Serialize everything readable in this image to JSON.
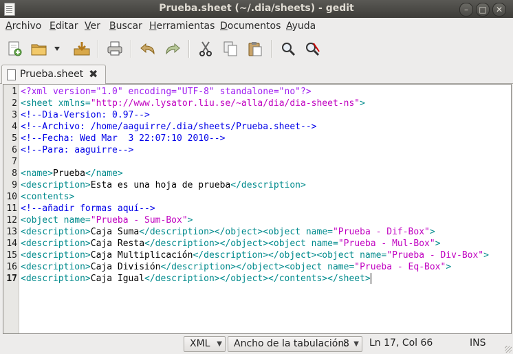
{
  "window": {
    "title": "Prueba.sheet (~/.dia/sheets) - gedit",
    "controls": {
      "minimize": "–",
      "maximize": "□",
      "close": "✕"
    }
  },
  "menu": {
    "items": [
      "Archivo",
      "Editar",
      "Ver",
      "Buscar",
      "Herramientas",
      "Documentos",
      "Ayuda"
    ]
  },
  "toolbar": {
    "icons": [
      "new-document-icon",
      "open-icon",
      "open-dropdown-icon",
      "save-icon",
      "print-icon",
      "undo-icon",
      "redo-icon",
      "cut-icon",
      "copy-icon",
      "paste-icon",
      "find-icon",
      "find-replace-icon"
    ]
  },
  "tab": {
    "label": "Prueba.sheet",
    "close": "✖"
  },
  "editor": {
    "current_line": 17,
    "lines": [
      [
        [
          "pi",
          "<?xml version=\"1.0\" encoding=\"UTF-8\" standalone=\"no\"?>"
        ]
      ],
      [
        [
          "tag",
          "<sheet "
        ],
        [
          "attr",
          "xmlns="
        ],
        [
          "str",
          "\"http://www.lysator.liu.se/~alla/dia/dia-sheet-ns\""
        ],
        [
          "tag",
          ">"
        ]
      ],
      [
        [
          "com",
          "<!--Dia-Version: 0.97-->"
        ]
      ],
      [
        [
          "com",
          "<!--Archivo: /home/aaguirre/.dia/sheets/Prueba.sheet-->"
        ]
      ],
      [
        [
          "com",
          "<!--Fecha: Wed Mar  3 22:07:10 2010-->"
        ]
      ],
      [
        [
          "com",
          "<!--Para: aaguirre-->"
        ]
      ],
      [
        [
          "txt",
          ""
        ]
      ],
      [
        [
          "tag",
          "<name>"
        ],
        [
          "txt",
          "Prueba"
        ],
        [
          "tag",
          "</name>"
        ]
      ],
      [
        [
          "tag",
          "<description>"
        ],
        [
          "txt",
          "Esta es una hoja de prueba"
        ],
        [
          "tag",
          "</description>"
        ]
      ],
      [
        [
          "tag",
          "<contents>"
        ]
      ],
      [
        [
          "com",
          "<!--añadir formas aquí-->"
        ]
      ],
      [
        [
          "tag",
          "<object "
        ],
        [
          "attr",
          "name="
        ],
        [
          "str",
          "\"Prueba - Sum-Box\""
        ],
        [
          "tag",
          ">"
        ]
      ],
      [
        [
          "tag",
          "<description>"
        ],
        [
          "txt",
          "Caja Suma"
        ],
        [
          "tag",
          "</description></object><object "
        ],
        [
          "attr",
          "name="
        ],
        [
          "str",
          "\"Prueba - Dif-Box\""
        ],
        [
          "tag",
          ">"
        ]
      ],
      [
        [
          "tag",
          "<description>"
        ],
        [
          "txt",
          "Caja Resta"
        ],
        [
          "tag",
          "</description></object><object "
        ],
        [
          "attr",
          "name="
        ],
        [
          "str",
          "\"Prueba - Mul-Box\""
        ],
        [
          "tag",
          ">"
        ]
      ],
      [
        [
          "tag",
          "<description>"
        ],
        [
          "txt",
          "Caja Multiplicación"
        ],
        [
          "tag",
          "</description></object><object "
        ],
        [
          "attr",
          "name="
        ],
        [
          "str",
          "\"Prueba - Div-Box\""
        ],
        [
          "tag",
          ">"
        ]
      ],
      [
        [
          "tag",
          "<description>"
        ],
        [
          "txt",
          "Caja División"
        ],
        [
          "tag",
          "</description></object><object "
        ],
        [
          "attr",
          "name="
        ],
        [
          "str",
          "\"Prueba - Eq-Box\""
        ],
        [
          "tag",
          ">"
        ]
      ],
      [
        [
          "tag",
          "<description>"
        ],
        [
          "txt",
          "Caja Igual"
        ],
        [
          "tag",
          "</description></object></contents></sheet>"
        ]
      ]
    ]
  },
  "status": {
    "language": "XML",
    "tab_width_label": "Ancho de la tabulación:",
    "tab_width_value": "8",
    "position": "Ln 17, Col 66",
    "mode": "INS"
  }
}
